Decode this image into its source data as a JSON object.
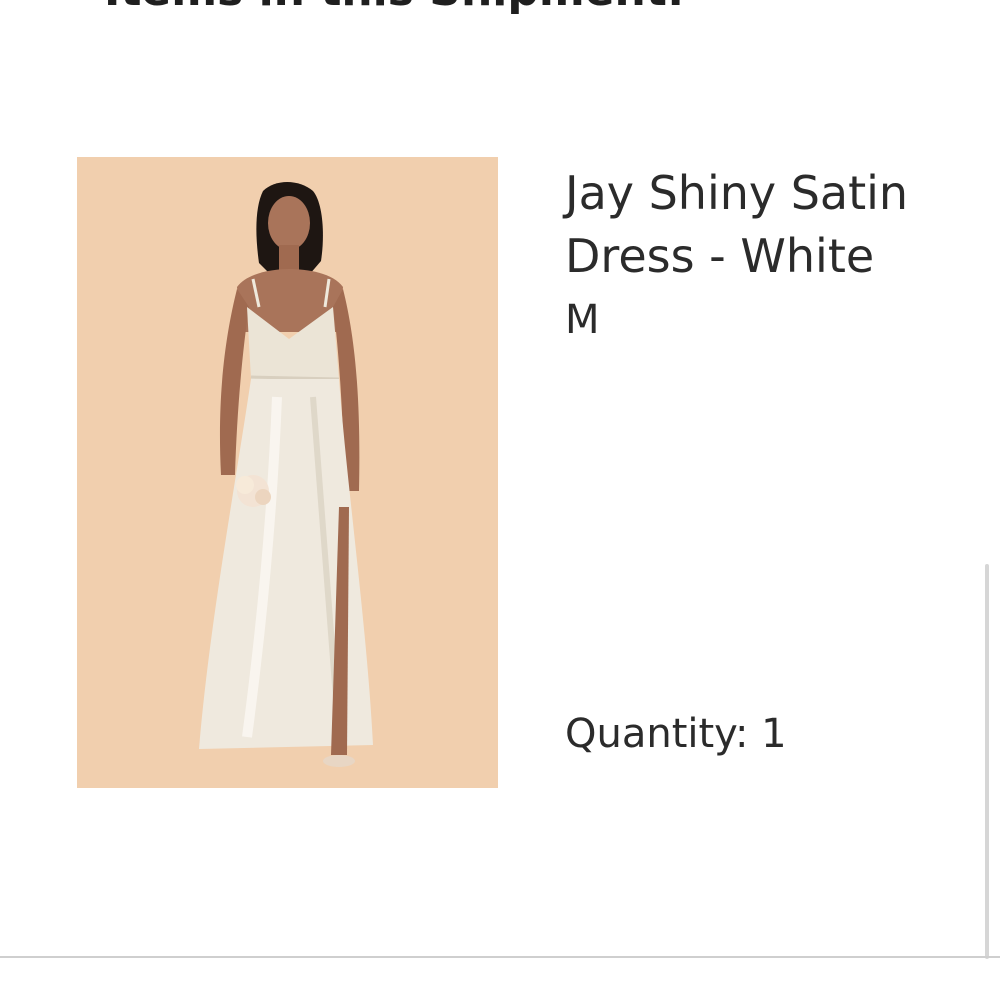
{
  "section": {
    "heading": "Items in this Shipment:"
  },
  "item": {
    "name": "Jay Shiny Satin Dress - White",
    "size": "M",
    "quantity_label": "Quantity:",
    "quantity": "1",
    "image_alt": "model wearing white satin dress"
  },
  "colors": {
    "image_background": "#f1cfae",
    "text": "#2b2b2b",
    "divider": "#cfcfcf"
  }
}
